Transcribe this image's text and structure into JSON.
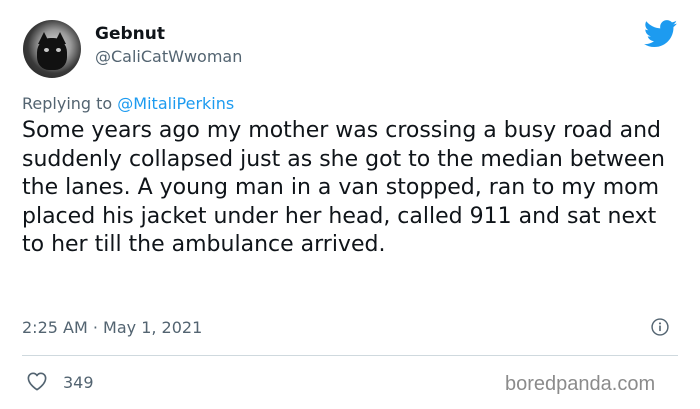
{
  "tweet": {
    "display_name": "Gebnut",
    "handle": "@CaliCatWwoman",
    "reply_prefix": "Replying to ",
    "reply_mention": "@MitaliPerkins",
    "text": "Some years ago my mother was crossing a busy road and suddenly collapsed just as she got to the median between the lanes. A young man in a van stopped, ran to my mom placed his jacket under her head, called 911 and sat next to her till the ambulance arrived.",
    "timestamp": "2:25 AM · May 1, 2021",
    "likes": "349"
  },
  "icons": {
    "brand": "twitter-bird-icon",
    "info": "info-icon",
    "like": "heart-icon"
  },
  "colors": {
    "accent": "#1d9bf0",
    "secondary_text": "#536471",
    "divider": "#cfd9de"
  },
  "watermark": "boredpanda.com"
}
